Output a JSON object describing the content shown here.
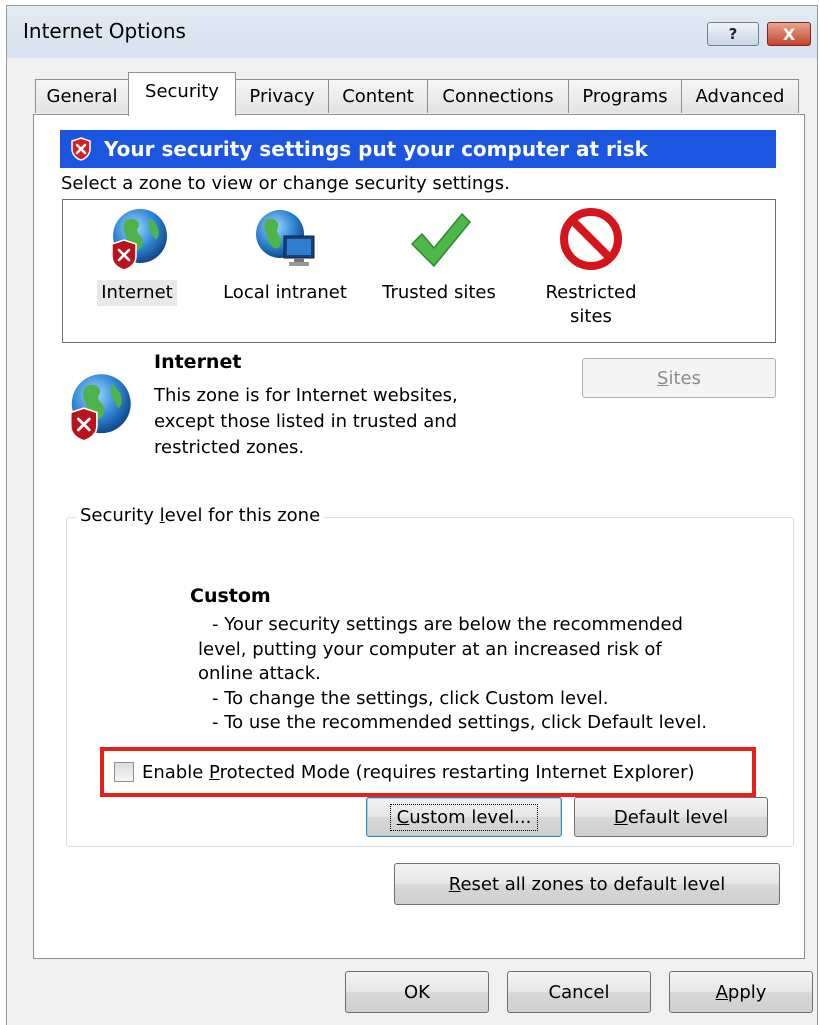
{
  "window": {
    "title": "Internet Options",
    "help_label": "?",
    "close_label": "X"
  },
  "tabs": [
    {
      "label": "General"
    },
    {
      "label": "Security",
      "active": true
    },
    {
      "label": "Privacy"
    },
    {
      "label": "Content"
    },
    {
      "label": "Connections"
    },
    {
      "label": "Programs"
    },
    {
      "label": "Advanced"
    }
  ],
  "warning": {
    "text": "Your security settings put your computer at risk",
    "icon": "shield-x-icon",
    "color": "#1b55e0"
  },
  "zone_prompt": "Select a zone to view or change security settings.",
  "zones": [
    {
      "label": "Internet",
      "icon": "globe-shield-icon",
      "selected": true
    },
    {
      "label": "Local intranet",
      "icon": "globe-monitor-icon"
    },
    {
      "label": "Trusted sites",
      "icon": "checkmark-icon"
    },
    {
      "label": "Restricted sites",
      "icon": "prohibited-icon"
    }
  ],
  "selected_zone": {
    "title": "Internet",
    "description_lines": [
      "This zone is for Internet websites,",
      "except those listed in trusted and",
      "restricted zones."
    ]
  },
  "sites_button": {
    "pre": "",
    "accel": "S",
    "post": "ites",
    "enabled": false
  },
  "security_level": {
    "legend_pre": "Security ",
    "legend_accel": "l",
    "legend_post": "evel for this zone",
    "level_name": "Custom",
    "lines": [
      "- Your security settings are below the recommended",
      "level, putting your computer at an increased risk of",
      "online attack.",
      "- To change the settings, click Custom level.",
      "- To use the recommended settings, click Default level."
    ]
  },
  "protected_mode": {
    "label_pre": "Enable ",
    "label_accel": "P",
    "label_post": "rotected Mode (requires restarting Internet Explorer)",
    "checked": false,
    "highlight_color": "#e8201c"
  },
  "buttons": {
    "custom_level": {
      "pre": "",
      "accel": "C",
      "post": "ustom level..."
    },
    "default_level": {
      "pre": "",
      "accel": "D",
      "post": "efault level"
    },
    "reset_all": {
      "pre": "",
      "accel": "R",
      "post": "eset all zones to default level"
    },
    "ok": "OK",
    "cancel": "Cancel",
    "apply": {
      "pre": "",
      "accel": "A",
      "post": "pply"
    }
  }
}
